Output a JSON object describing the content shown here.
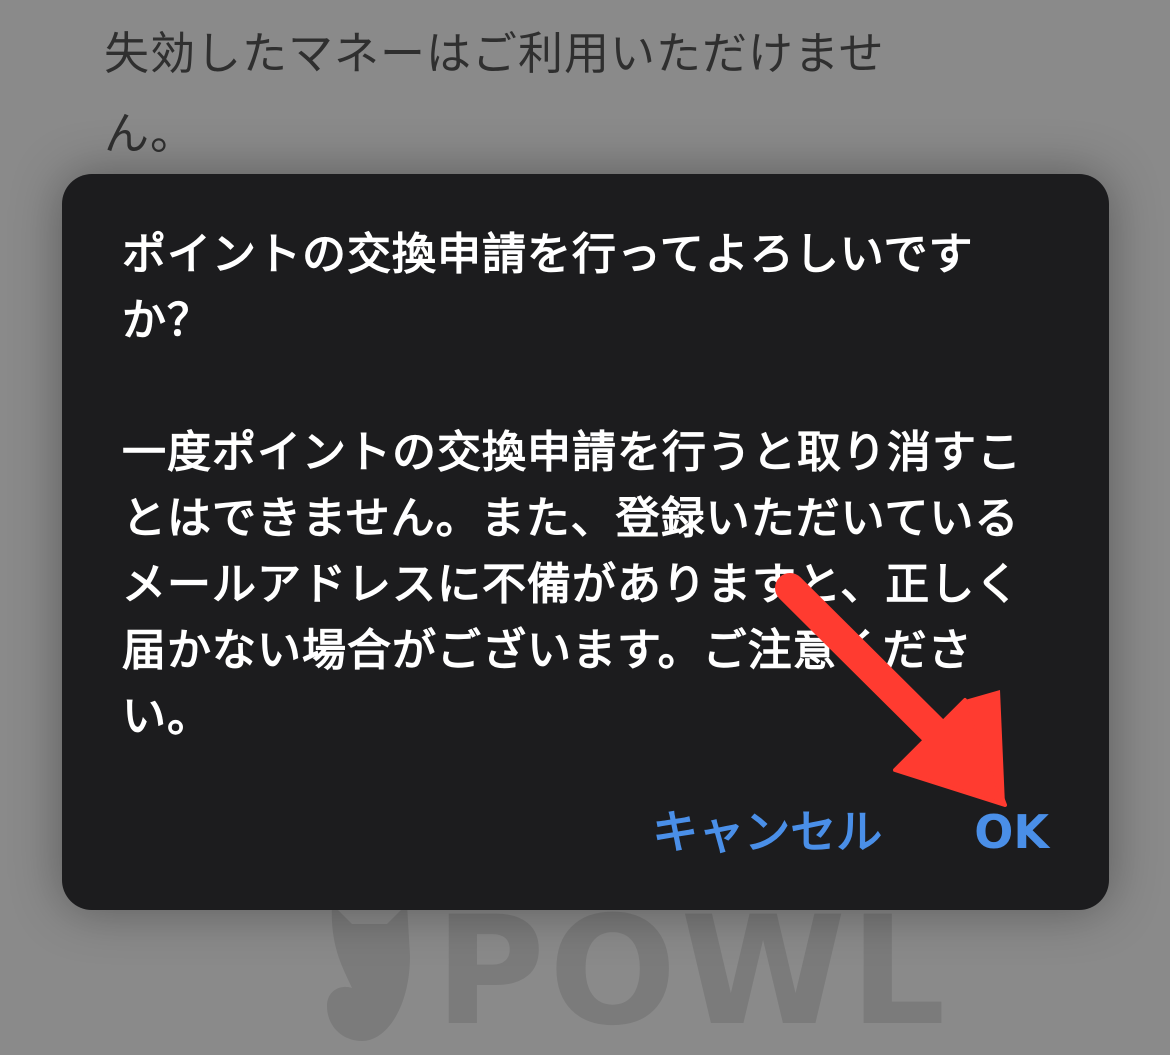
{
  "background": {
    "text": "失効したマネーはご利用いただけません。",
    "brand": "POWL"
  },
  "dialog": {
    "title": "ポイントの交換申請を行ってよろしいですか？",
    "message": "一度ポイントの交換申請を行うと取り消すことはできません。また、登録いただいているメールアドレスに不備がありますと、正しく届かない場合がございます。ご注意ください。",
    "cancel_label": "キャンセル",
    "ok_label": "OK"
  },
  "colors": {
    "dialog_bg": "#1c1c1e",
    "button_text": "#4a8fe8",
    "arrow": "#ff3b30",
    "overlay": "#8a8a8a"
  },
  "icons": {
    "annotation": "arrow-pointing-to-ok-icon",
    "brand": "owl-logo-icon"
  }
}
